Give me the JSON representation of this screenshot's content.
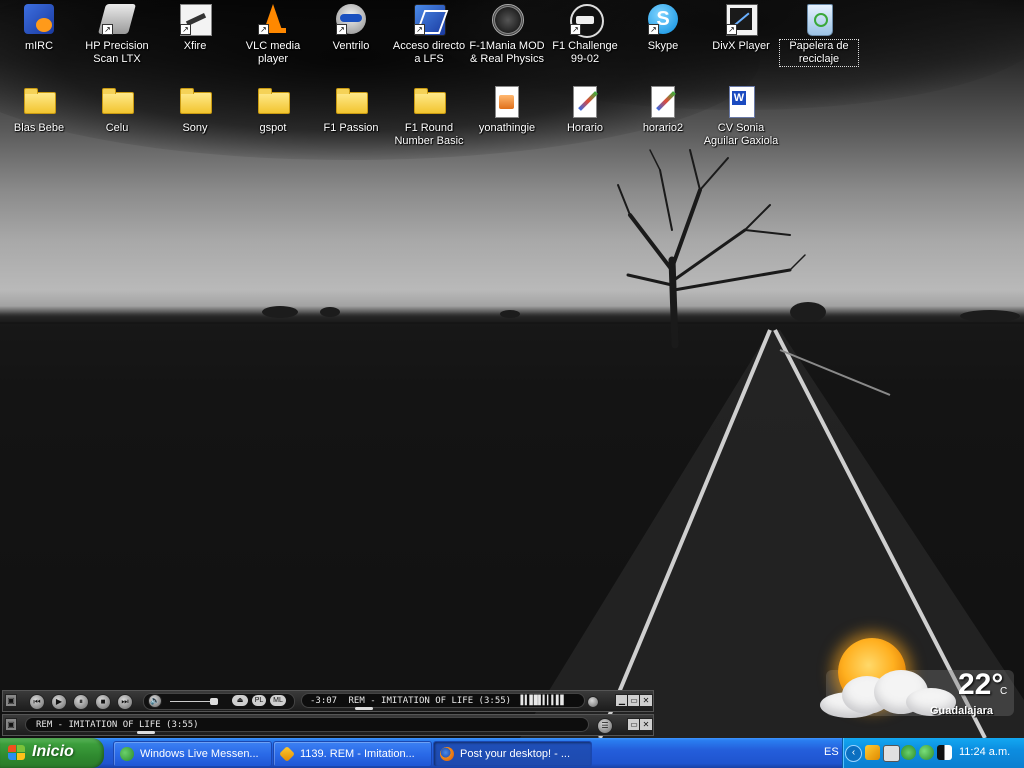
{
  "desktop": {
    "icons_row1": [
      {
        "label": "mIRC",
        "icon": "mirc-icon"
      },
      {
        "label": "HP Precision Scan LTX",
        "icon": "scanner-icon"
      },
      {
        "label": "Xfire",
        "icon": "xfire-icon"
      },
      {
        "label": "VLC media player",
        "icon": "vlc-cone-icon"
      },
      {
        "label": "Ventrilo",
        "icon": "ventrilo-headset-icon"
      },
      {
        "label": "Acceso directo a LFS",
        "icon": "lfs-icon"
      },
      {
        "label": "F-1Mania MOD & Real Physics",
        "icon": "f1mania-icon"
      },
      {
        "label": "F1 Challenge 99-02",
        "icon": "f1-challenge-icon"
      },
      {
        "label": "Skype",
        "icon": "skype-icon"
      },
      {
        "label": "DivX Player",
        "icon": "divx-icon"
      },
      {
        "label": "Papelera de reciclaje",
        "icon": "recycle-bin-icon"
      }
    ],
    "icons_row2": [
      {
        "label": "Blas Bebe",
        "icon": "folder-icon"
      },
      {
        "label": "Celu",
        "icon": "folder-icon"
      },
      {
        "label": "Sony",
        "icon": "folder-icon"
      },
      {
        "label": "gspot",
        "icon": "folder-icon"
      },
      {
        "label": "F1 Passion",
        "icon": "folder-icon"
      },
      {
        "label": "F1 Round Number Basic",
        "icon": "folder-icon"
      },
      {
        "label": "yonathingie",
        "icon": "paint-image-icon"
      },
      {
        "label": "Horario",
        "icon": "paint-brush-icon"
      },
      {
        "label": "horario2",
        "icon": "paint-brush-icon"
      },
      {
        "label": "CV Sonia Aguilar Gaxiola",
        "icon": "word-document-icon"
      }
    ]
  },
  "weather": {
    "temperature": "22°",
    "unit": "C",
    "city": "Guadalajara",
    "condition_icon": "partly-cloudy-icon"
  },
  "winamp": {
    "time": "-3:07",
    "track_scroll": "REM - IMITATION OF LIFE (3:55)",
    "playlist_text": "REM - IMITATION OF LIFE (3:55)",
    "eject_label": "⏏",
    "pl_label": "PL",
    "ml_label": "ML"
  },
  "taskbar": {
    "start_label": "Inicio",
    "tasks": [
      {
        "label": "Windows Live Messen...",
        "icon": "messenger-icon"
      },
      {
        "label": "1139. REM - Imitation...",
        "icon": "winamp-icon"
      },
      {
        "label": "Post your desktop! - ...",
        "icon": "firefox-icon"
      }
    ],
    "language": "ES",
    "clock": "11:24 a.m."
  },
  "colors": {
    "taskbar_blue": "#245edb",
    "start_green": "#3c9e3c",
    "tray_blue": "#0c8de0",
    "sun_orange": "#ffb020"
  }
}
